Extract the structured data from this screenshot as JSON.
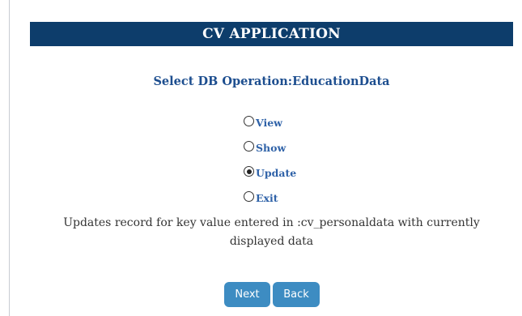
{
  "header": {
    "title": "CV APPLICATION"
  },
  "form": {
    "heading": "Select DB Operation:EducationData",
    "options": [
      {
        "label": "View",
        "checked": false
      },
      {
        "label": "Show",
        "checked": false
      },
      {
        "label": "Update",
        "checked": true
      },
      {
        "label": "Exit",
        "checked": false
      }
    ],
    "description_line1": "Updates record for key value entered in :cv_personaldata with currently",
    "description_line2": "displayed data"
  },
  "buttons": {
    "next_label": "Next",
    "back_label": "Back"
  },
  "colors": {
    "header_bg": "#0d3d6b",
    "heading_text": "#1d4e8f",
    "option_text": "#2f62a8",
    "button_bg": "#3d8cc2"
  },
  "icons": {
    "radio_unselected": "radio-unselected-icon",
    "radio_selected": "radio-selected-icon"
  }
}
